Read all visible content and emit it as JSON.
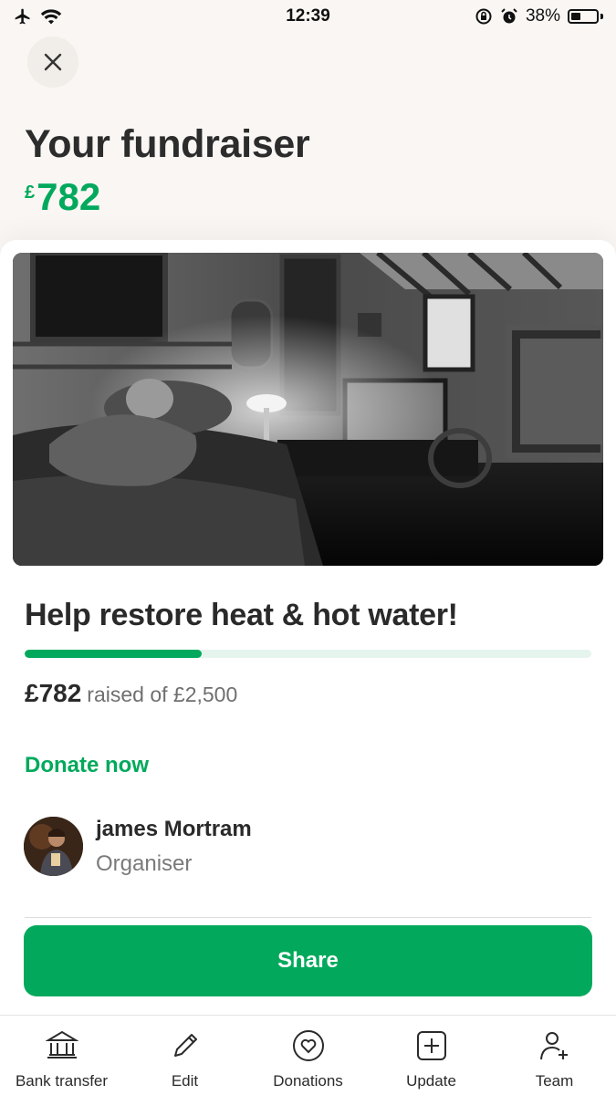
{
  "status_bar": {
    "time": "12:39",
    "battery_percent": "38%",
    "battery_level": 0.38
  },
  "header": {
    "title": "Your fundraiser",
    "amount_currency": "£",
    "amount_value": "782"
  },
  "campaign": {
    "title": "Help restore heat & hot water!",
    "raised": "£782",
    "raised_suffix": "raised of £2,500",
    "progress_fraction": 0.313,
    "donate_label": "Donate now"
  },
  "organiser": {
    "name": "james Mortram",
    "role": "Organiser"
  },
  "share_label": "Share",
  "tabs": [
    {
      "label": "Bank transfer",
      "icon": "bank-icon"
    },
    {
      "label": "Edit",
      "icon": "pencil-icon"
    },
    {
      "label": "Donations",
      "icon": "heart-icon"
    },
    {
      "label": "Update",
      "icon": "plus-square-icon"
    },
    {
      "label": "Team",
      "icon": "add-person-icon"
    }
  ],
  "colors": {
    "accent": "#02a95c",
    "background": "#f9f6f3",
    "progress_track": "#e6f4ee"
  }
}
